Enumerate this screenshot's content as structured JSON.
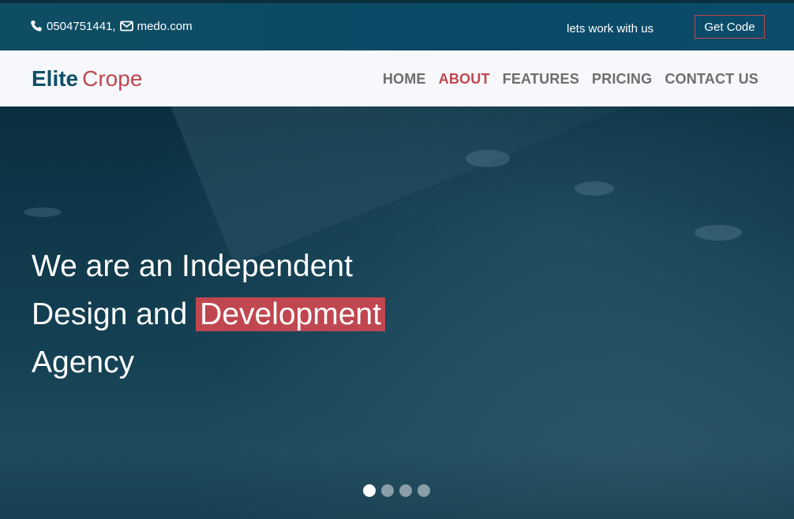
{
  "topbar": {
    "phone": "0504751441,",
    "email": "medo.com",
    "work_link": "lets work with us",
    "cta": "Get Code"
  },
  "logo": {
    "part1": "Elite",
    "part2": "Crope"
  },
  "nav": {
    "items": [
      {
        "label": "HOME"
      },
      {
        "label": "ABOUT"
      },
      {
        "label": "FEATURES"
      },
      {
        "label": "PRICING"
      },
      {
        "label": "CONTACT US"
      }
    ],
    "active_index": 1
  },
  "hero": {
    "line1": "We are an Independent",
    "line2_pre": "Design and",
    "line2_highlight": "Development",
    "line3": "Agency"
  },
  "carousel": {
    "slides": 4,
    "active": 0
  },
  "colors": {
    "brand_teal": "#0d4e66",
    "accent_red": "#c0474f",
    "nav_text": "#6e6e6e"
  }
}
